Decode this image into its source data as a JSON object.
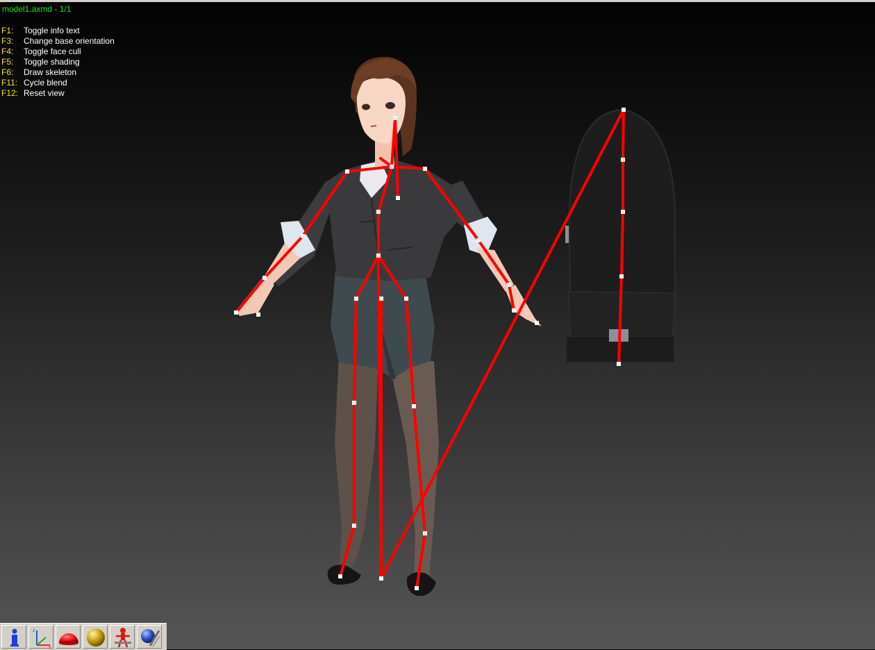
{
  "window": {
    "title": "model1.axmd - 1/1"
  },
  "help": [
    {
      "key": "F1:",
      "desc": "Toggle info text"
    },
    {
      "key": "F3:",
      "desc": "Change base orientation"
    },
    {
      "key": "F4:",
      "desc": "Toggle face cull"
    },
    {
      "key": "F5:",
      "desc": "Toggle shading"
    },
    {
      "key": "F6:",
      "desc": "Draw skeleton"
    },
    {
      "key": "F11:",
      "desc": "Cycle blend"
    },
    {
      "key": "F12:",
      "desc": "Reset view"
    }
  ],
  "toolbar": {
    "tools": [
      {
        "icon": "info-icon"
      },
      {
        "icon": "axes-icon",
        "axis_labels": [
          "z",
          "x"
        ]
      },
      {
        "icon": "hemisphere-icon"
      },
      {
        "icon": "sphere-icon"
      },
      {
        "icon": "skeleton-figure-icon"
      },
      {
        "icon": "globe-tools-icon"
      }
    ]
  },
  "colors": {
    "title": "#1fe51f",
    "help_key": "#f4e22a",
    "help_desc": "#ffffff",
    "skeleton": "#ff0000",
    "joint": "#ffffff",
    "toolbar": "#d4d0c8"
  }
}
